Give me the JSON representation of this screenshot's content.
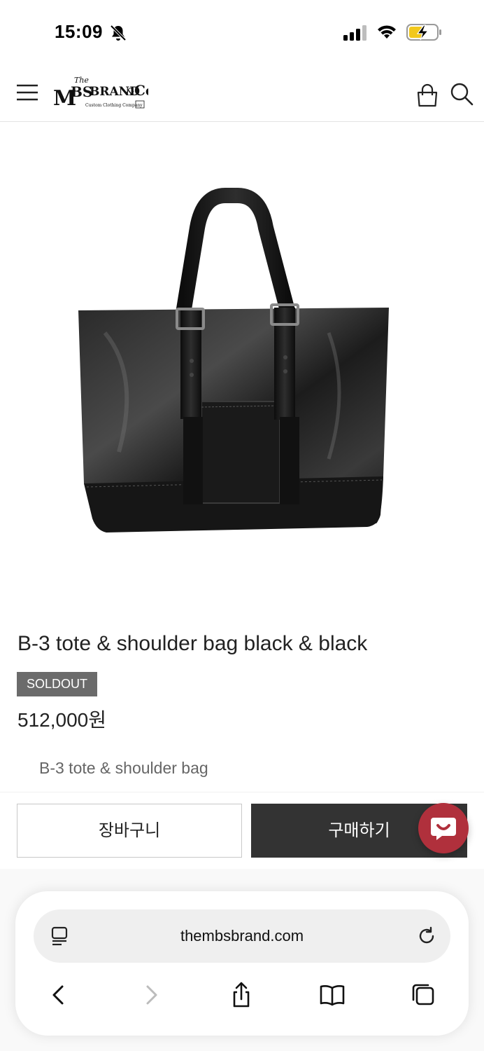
{
  "status_bar": {
    "time": "15:09"
  },
  "header": {
    "logo_alt": "The MBS BRAND & Co. Custom Clothing Company"
  },
  "product": {
    "title": "B-3 tote & shoulder bag black & black",
    "badge": "SOLDOUT",
    "price": "512,000원",
    "description": "B-3 tote & shoulder bag"
  },
  "actions": {
    "cart_label": "장바구니",
    "buy_label": "구매하기"
  },
  "browser": {
    "url": "thembsbrand.com"
  }
}
